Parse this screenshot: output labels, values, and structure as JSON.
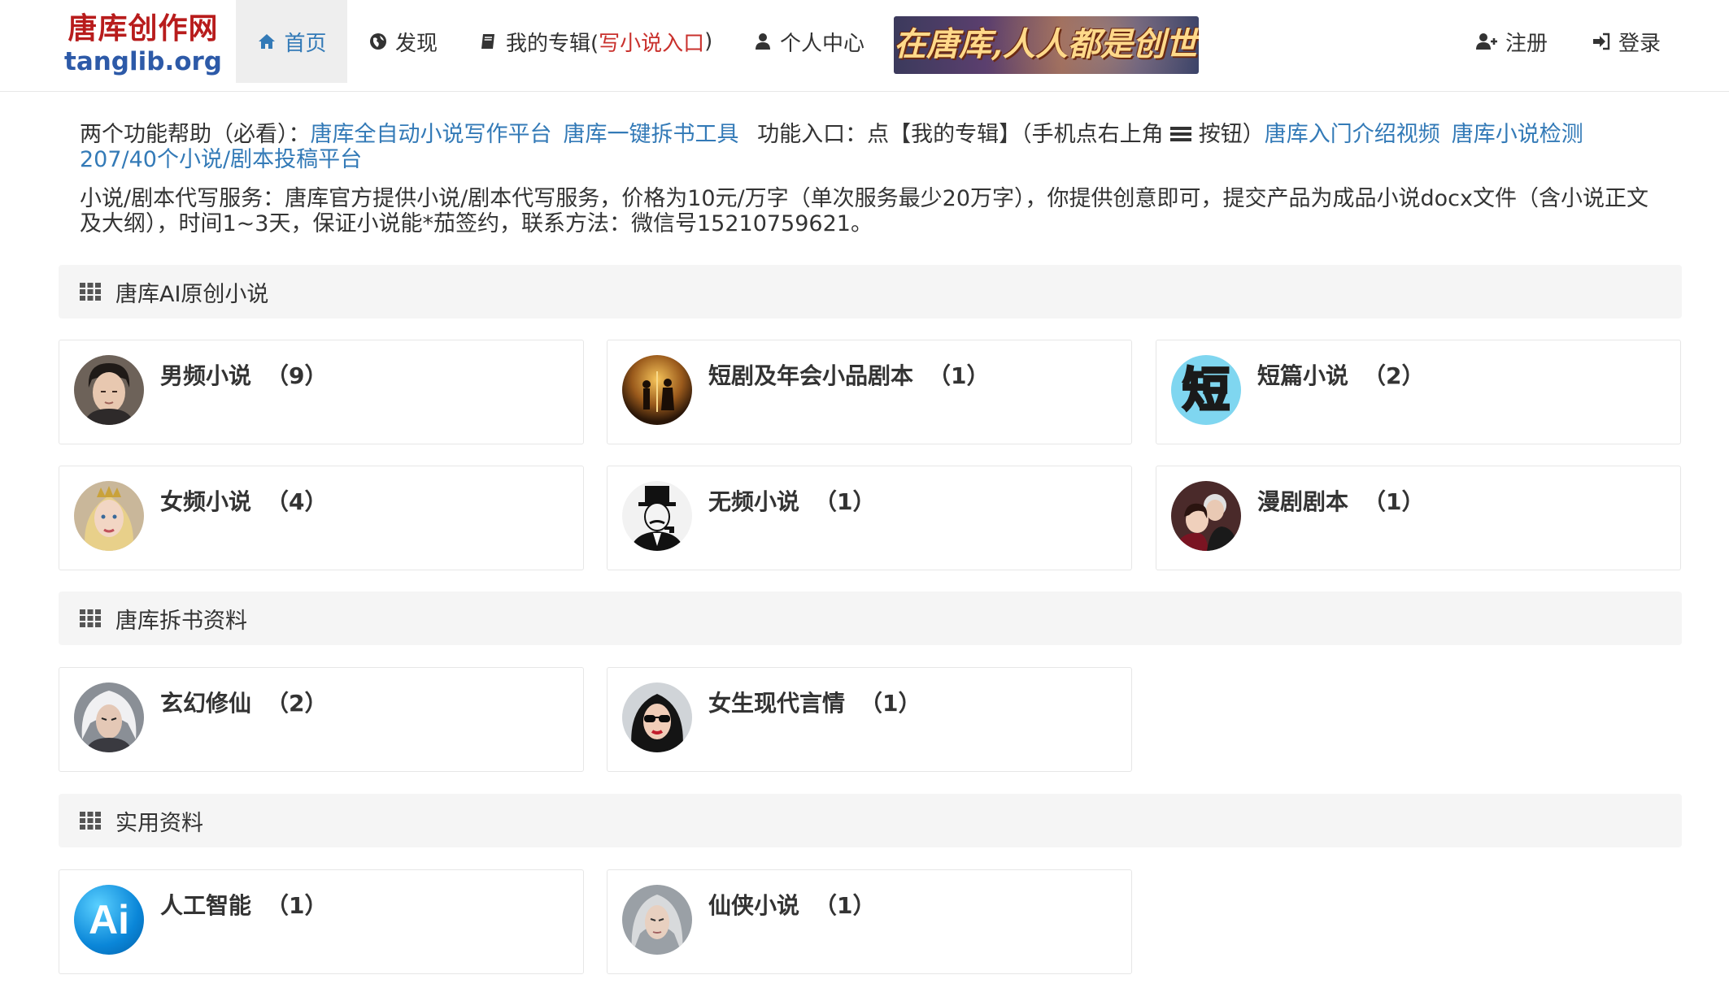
{
  "header": {
    "brand_cn": "唐库创作网",
    "brand_en": "tanglib.org",
    "nav": [
      {
        "label": "首页",
        "icon": "home-icon",
        "active": true
      },
      {
        "label": "发现",
        "icon": "globe-icon"
      },
      {
        "label": "我的专辑(",
        "highlight": "写小说入口",
        "suffix": ")",
        "icon": "book-icon"
      },
      {
        "label": "个人中心",
        "icon": "user-icon"
      }
    ],
    "banner_text": "在唐库,人人都是创世神!",
    "register": "注册",
    "login": "登录"
  },
  "notice": {
    "line1": {
      "prefix": "两个功能帮助（必看）：",
      "link1": "唐库全自动小说写作平台",
      "link2": "唐库一键拆书工具",
      "entry_prefix": "功能入口：点【我的专辑】（手机点右上角",
      "entry_suffix": "按钮）",
      "link3": "唐库入门介绍视频",
      "link4": "唐库小说检测",
      "link5": "207/40个小说/剧本投稿平台"
    },
    "line2": "小说/剧本代写服务：唐库官方提供小说/剧本代写服务，价格为10元/万字（单次服务最少20万字），你提供创意即可，提交产品为成品小说docx文件（含小说正文及大纲），时间1~3天，保证小说能*茄签约，联系方法：微信号15210759621。"
  },
  "sections": [
    {
      "title": "唐库AI原创小说",
      "cards": [
        {
          "title": "男频小说",
          "count": "（9）",
          "avatar": "male-portrait-avatar"
        },
        {
          "title": "短剧及年会小品剧本",
          "count": "（1）",
          "avatar": "stage-silhouettes-avatar"
        },
        {
          "title": "短篇小说",
          "count": "（2）",
          "avatar": "short-character-avatar",
          "avatar_text": "短"
        },
        {
          "title": "女频小说",
          "count": "（4）",
          "avatar": "female-portrait-avatar"
        },
        {
          "title": "无频小说",
          "count": "（1）",
          "avatar": "top-hat-man-avatar"
        },
        {
          "title": "漫剧剧本",
          "count": "（1）",
          "avatar": "couple-avatar"
        }
      ]
    },
    {
      "title": "唐库拆书资料",
      "cards": [
        {
          "title": "玄幻修仙",
          "count": "（2）",
          "avatar": "white-hair-hero-avatar"
        },
        {
          "title": "女生现代言情",
          "count": "（1）",
          "avatar": "sunglasses-woman-avatar"
        }
      ]
    },
    {
      "title": "实用资料",
      "cards": [
        {
          "title": "人工智能",
          "count": "（1）",
          "avatar": "ai-logo-avatar",
          "avatar_text": "Ai"
        },
        {
          "title": "仙侠小说",
          "count": "（1）",
          "avatar": "silver-hair-swordsman-avatar"
        }
      ]
    }
  ],
  "colors": {
    "brand_red": "#b81c1c",
    "brand_blue": "#2d5aa8",
    "link": "#337ab7",
    "highlight_red": "#c9302c",
    "section_bg": "#f5f5f5"
  }
}
